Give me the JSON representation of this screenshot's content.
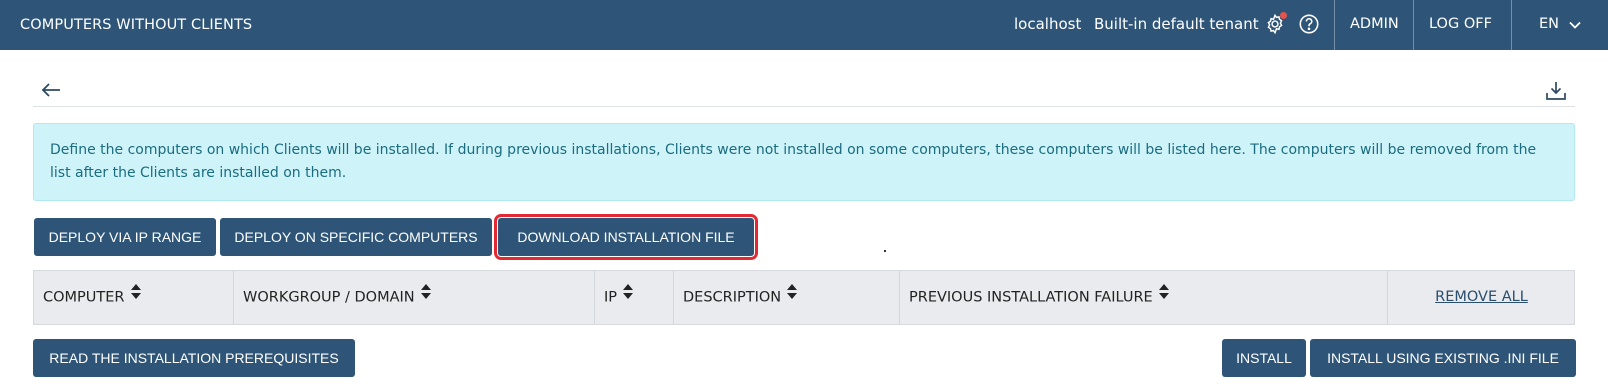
{
  "header": {
    "title": "COMPUTERS WITHOUT CLIENTS",
    "host": "localhost",
    "tenant": "Built-in default tenant",
    "admin_label": "ADMIN",
    "logoff_label": "LOG OFF",
    "language": "EN",
    "icons": [
      "gear-icon",
      "help-icon",
      "chevron-down-icon"
    ],
    "colors": {
      "bar": "#2e5577",
      "notification_dot": "#e5534b"
    }
  },
  "toolbar": {
    "icons": [
      "back-arrow-icon",
      "download-icon"
    ]
  },
  "info_message": "Define the computers on which Clients will be installed. If during previous installations, Clients were not installed on some computers, these computers will be listed here. The computers will be removed from the list after the Clients are installed on them.",
  "deploy_buttons": {
    "ip_range": "DEPLOY VIA IP RANGE",
    "specific": "DEPLOY ON SPECIFIC COMPUTERS",
    "download": "DOWNLOAD INSTALLATION FILE"
  },
  "table": {
    "columns": [
      "COMPUTER",
      "WORKGROUP / DOMAIN",
      "IP",
      "DESCRIPTION",
      "PREVIOUS INSTALLATION FAILURE"
    ],
    "remove_all": "REMOVE ALL",
    "rows": []
  },
  "footer": {
    "prereq": "READ THE INSTALLATION PREREQUISITES",
    "install": "INSTALL",
    "install_ini": "INSTALL USING EXISTING .INI FILE"
  },
  "colors": {
    "primary": "#2e5577",
    "info_bg": "#cef4fa",
    "info_text": "#1b6c7f",
    "highlight": "#e32a34"
  }
}
